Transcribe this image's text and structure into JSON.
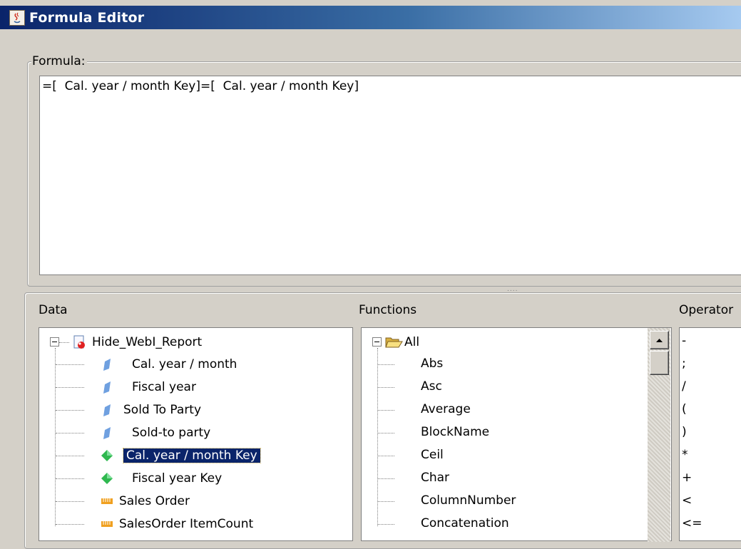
{
  "window": {
    "title": "Formula Editor"
  },
  "formula": {
    "legend": "Formula:",
    "text": "=[  Cal. year / month Key]=[  Cal. year / month Key]"
  },
  "data": {
    "label": "Data",
    "root": "Hide_WebI_Report",
    "items": [
      {
        "label": "Cal. year / month",
        "icon": "dimension-icon"
      },
      {
        "label": "Fiscal year",
        "icon": "dimension-icon"
      },
      {
        "label": "Sold To Party",
        "icon": "dimension-icon"
      },
      {
        "label": "Sold-to party",
        "icon": "dimension-icon"
      },
      {
        "label": "Cal. year / month Key",
        "icon": "detail-icon",
        "selected": true
      },
      {
        "label": "Fiscal year Key",
        "icon": "detail-icon"
      },
      {
        "label": "Sales Order",
        "icon": "measure-icon"
      },
      {
        "label": "SalesOrder ItemCount",
        "icon": "measure-icon"
      }
    ]
  },
  "functions": {
    "label": "Functions",
    "root": "All",
    "items": [
      "Abs",
      "Asc",
      "Average",
      "BlockName",
      "Ceil",
      "Char",
      "ColumnNumber",
      "Concatenation"
    ]
  },
  "operators": {
    "label": "Operator",
    "items": [
      "-",
      ";",
      "/",
      "(",
      ")",
      "*",
      "+",
      "<",
      "<="
    ]
  },
  "colors": {
    "selection": "#0a246a",
    "background": "#d4d0c8"
  }
}
